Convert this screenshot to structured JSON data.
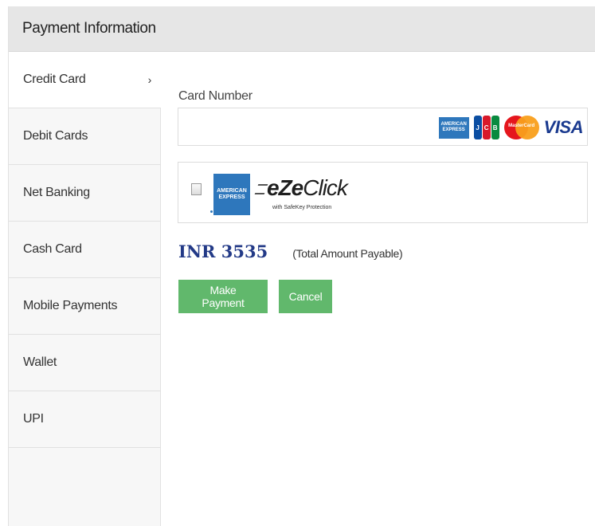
{
  "header": {
    "title": "Payment Information"
  },
  "sidebar": {
    "items": [
      {
        "label": "Credit Card",
        "active": true,
        "chevron": "›"
      },
      {
        "label": "Debit Cards"
      },
      {
        "label": "Net Banking"
      },
      {
        "label": "Cash Card"
      },
      {
        "label": "Mobile Payments"
      },
      {
        "label": "Wallet"
      },
      {
        "label": "UPI"
      }
    ]
  },
  "card": {
    "label": "Card Number",
    "value": "",
    "logos": {
      "amex": "AMERICAN EXPRESS",
      "jcb": "JCB",
      "mastercard": "MasterCard",
      "visa": "VISA"
    }
  },
  "ezeclick": {
    "checked": false,
    "amex_text": "AMERICAN EXPRESS",
    "brand_prefix": "eZe",
    "brand_suffix": "Click",
    "subtitle": "with SafeKey Protection"
  },
  "amount": {
    "value": "INR 3535",
    "note": "(Total Amount Payable)"
  },
  "actions": {
    "pay_label": "Make Payment",
    "cancel_label": "Cancel"
  },
  "colors": {
    "button": "#61b86c",
    "amount": "#233a87",
    "header_bg": "#e6e6e6"
  }
}
